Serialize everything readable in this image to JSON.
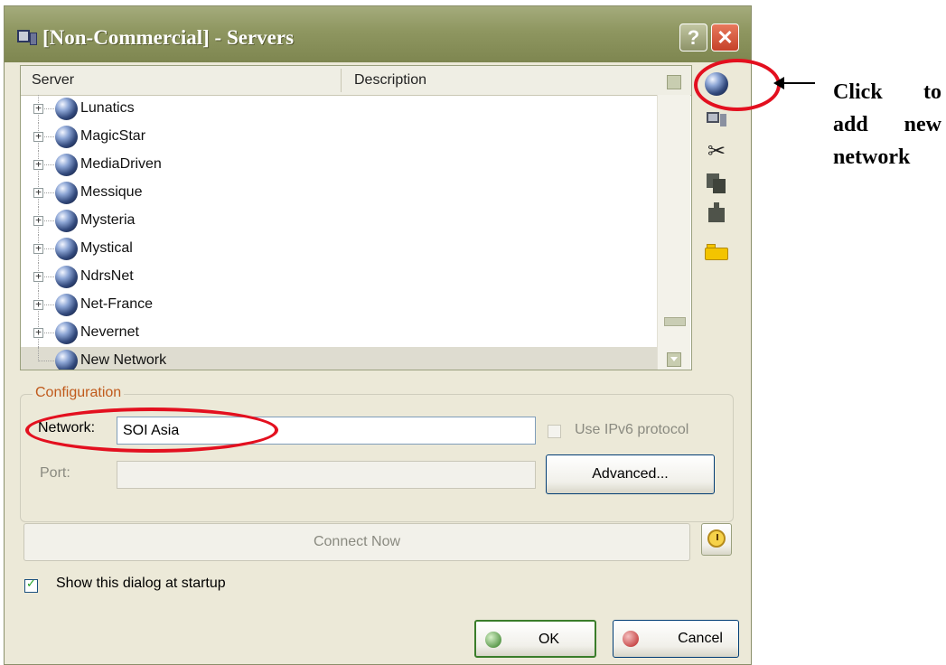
{
  "window": {
    "title": "[Non-Commercial] - Servers",
    "help_label": "?",
    "close_label": "✕"
  },
  "server_list": {
    "columns": [
      "Server",
      "Description"
    ],
    "items": [
      {
        "label": "Lunatics",
        "expandable": true
      },
      {
        "label": "MagicStar",
        "expandable": true
      },
      {
        "label": "MediaDriven",
        "expandable": true
      },
      {
        "label": "Messique",
        "expandable": true
      },
      {
        "label": "Mysteria",
        "expandable": true
      },
      {
        "label": "Mystical",
        "expandable": true
      },
      {
        "label": "NdrsNet",
        "expandable": true
      },
      {
        "label": "Net-France",
        "expandable": true
      },
      {
        "label": "Nevernet",
        "expandable": true
      },
      {
        "label": "New Network",
        "expandable": false,
        "selected": true
      }
    ],
    "expander_glyph": "+"
  },
  "toolbar": {
    "icons": [
      "globe-icon",
      "server-icon",
      "scissors-icon",
      "copy-icon",
      "paste-icon",
      "folder-icon"
    ],
    "cut_glyph": "✂"
  },
  "configuration": {
    "legend": "Configuration",
    "network_label": "Network:",
    "network_value": "SOI Asia",
    "ipv6_label": "Use IPv6 protocol",
    "ipv6_checked": false,
    "port_label": "Port:",
    "port_value": "",
    "advanced_label": "Advanced..."
  },
  "actions": {
    "connect_now_label": "Connect Now",
    "show_startup_label": "Show this dialog at startup",
    "show_startup_checked": true,
    "ok_label": "OK",
    "cancel_label": "Cancel"
  },
  "annotation": {
    "lines": [
      [
        "Click",
        "to"
      ],
      [
        "add",
        "new"
      ],
      [
        "network"
      ]
    ],
    "highlight_color": "#e3101f"
  }
}
